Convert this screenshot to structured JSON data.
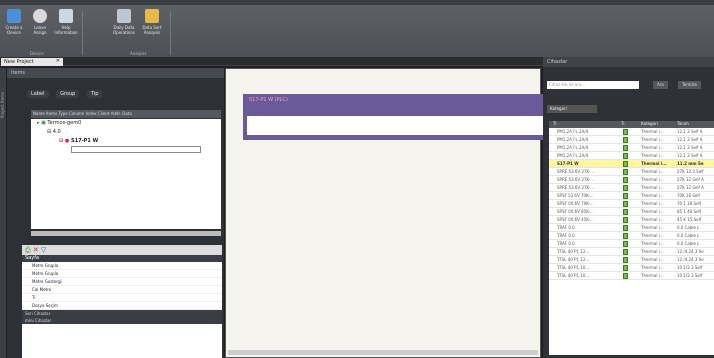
{
  "ribbon": {
    "buttons": [
      {
        "label": "Create a Device",
        "icon": "create-device-icon"
      },
      {
        "label": "Leave Assign",
        "icon": "leave-icon"
      },
      {
        "label": "Help Information",
        "icon": "help-icon"
      },
      {
        "label": "Daily Data Operations",
        "icon": "daily-data-icon"
      },
      {
        "label": "Data Sort Analysis",
        "icon": "data-sort-icon"
      }
    ],
    "group1": "Device",
    "group2": "Analysis"
  },
  "doc_tab": "New Project",
  "left_panel": {
    "header": "Items",
    "vertical_label": "Project Items",
    "toolbar": [
      "Label",
      "Group",
      "Tip"
    ],
    "columns": "Name   Items   Type   Column Index   Client Addr.   Data",
    "tree": [
      {
        "label": "Termos-gem0",
        "indent": 0
      },
      {
        "label": "4.0",
        "indent": 1
      },
      {
        "label": "S17-P1 W",
        "indent": 2
      },
      {
        "label": "",
        "indent": 3
      }
    ]
  },
  "lower_panel": {
    "toolbar_icons": [
      "S",
      "X",
      "filter"
    ],
    "header": "Sayfa",
    "items": [
      "Metre Grupla",
      "Metre Grupla",
      "Metre Gostergi",
      "Cal Metre",
      "Ti"
    ],
    "footer_label": "Dosya Seçim",
    "footer1": "Seri Cihazlar",
    "footer2": "mini Cihazlar"
  },
  "canvas": {
    "frame_label": "S17-P1 W (PLC)"
  },
  "right_panel": {
    "header": "Cihazlar",
    "search_placeholder": "Cihaz Adı ile ara...",
    "search_button": "Ara",
    "clear_button": "Temizle",
    "category": "Kategori",
    "columns": [
      "Ti",
      "Ti",
      "Kategori",
      "Tanım"
    ],
    "rows": [
      {
        "name": "PM1 2A FL 2A/4",
        "cat": "Thermal i...",
        "desc": "12.1 3 Self A"
      },
      {
        "name": "PM1 2A FL 2A/4",
        "cat": "Thermal i...",
        "desc": "12.1 3 Self A"
      },
      {
        "name": "PM1 2A FL 2A/4",
        "cat": "Thermal i...",
        "desc": "12.1 3 Self A"
      },
      {
        "name": "PM1 2A FL 2A/4",
        "cat": "Thermal i...",
        "desc": "12.1 3 Self A"
      },
      {
        "name": "S17-P1 W",
        "cat": "Thermal i...",
        "desc": "11.2 mm Se",
        "selected": true
      },
      {
        "name": "SPRE 53 6V 27K-...",
        "cat": "Thermal i...",
        "desc": "27K 12.3 Self"
      },
      {
        "name": "SPRE 53 6V 27K-...",
        "cat": "Thermal i...",
        "desc": "27K 12 Self A"
      },
      {
        "name": "SPRE 53 6V 27K-...",
        "cat": "Thermal i...",
        "desc": "27K 12 Self A"
      },
      {
        "name": "SPSF 53 6V 70K-...",
        "cat": "Thermal i...",
        "desc": "70K 16 Self"
      },
      {
        "name": "SPSF 0X 6V 70K-...",
        "cat": "Thermal i...",
        "desc": "70 1 16 Self"
      },
      {
        "name": "SPSF 0X 6V 85K-...",
        "cat": "Thermal i...",
        "desc": "85 1 40 Self"
      },
      {
        "name": "SPSF 0X 6V 45K-...",
        "cat": "Thermal i...",
        "desc": "45 K 15 Self"
      },
      {
        "name": "TRAF 0.0",
        "cat": "Thermal i...",
        "desc": "0.0 Cable L"
      },
      {
        "name": "TRAF 0.0",
        "cat": "Thermal i...",
        "desc": "0.0 Cable L"
      },
      {
        "name": "TRAF 0.0",
        "cat": "Thermal i...",
        "desc": "0.0 Cable L"
      },
      {
        "name": "TFSL 40 P1 12...",
        "cat": "Thermal i...",
        "desc": "12 /4 24 3 Se"
      },
      {
        "name": "TFSL 40 P1 12...",
        "cat": "Thermal i...",
        "desc": "12 /4 24 3 Se"
      },
      {
        "name": "TFSL 40 P1 10...",
        "cat": "Thermal i...",
        "desc": "10 1/2.3 Self"
      },
      {
        "name": "TFSL 40 P1 10...",
        "cat": "Thermal i...",
        "desc": "10 1/2.3 Self"
      }
    ]
  }
}
